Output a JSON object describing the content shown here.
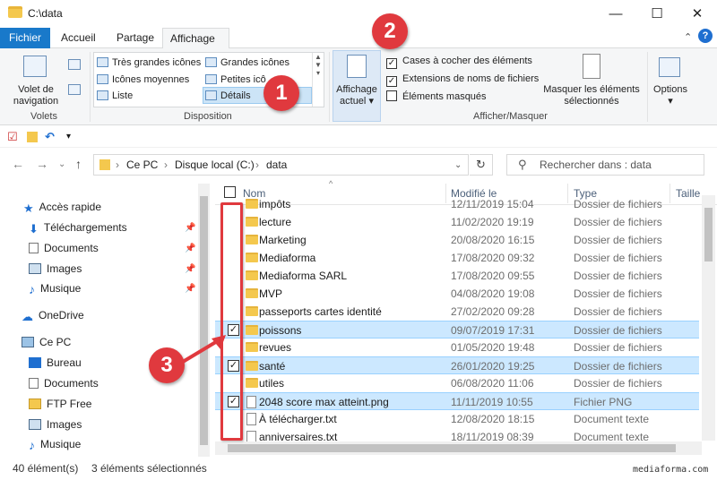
{
  "window": {
    "title": "C:\\data",
    "minimize_label": "—",
    "maximize_label": "☐",
    "close_label": "✕"
  },
  "tabs": [
    {
      "label": "Fichier"
    },
    {
      "label": "Accueil"
    },
    {
      "label": "Partage"
    },
    {
      "label": "Affichage"
    }
  ],
  "ribbon": {
    "panes": {
      "label_line1": "Volet de",
      "label_line2": "navigation",
      "group_label": "Volets"
    },
    "layout": {
      "items": [
        "Très grandes icônes",
        "Grandes icônes",
        "Icônes moyennes",
        "Petites icô",
        "Liste",
        "Détails"
      ],
      "group_label": "Disposition"
    },
    "current_view": {
      "label_line1": "Affichage",
      "label_line2": "actuel"
    },
    "show_hide": {
      "checkboxes": [
        {
          "label": "Cases à cocher des éléments",
          "checked": true
        },
        {
          "label": "Extensions de noms de fichiers",
          "checked": true
        },
        {
          "label": "Éléments masqués",
          "checked": false
        }
      ],
      "hide_selected_line1": "Masquer les éléments",
      "hide_selected_line2": "sélectionnés",
      "group_label": "Afficher/Masquer"
    },
    "options_label": "Options"
  },
  "address": {
    "crumbs": [
      "Ce PC",
      "Disque local (C:)",
      "data"
    ],
    "search_placeholder": "Rechercher dans : data"
  },
  "nav_pane": [
    {
      "label": "Accès rapide",
      "icon": "star-icon",
      "pinned": false
    },
    {
      "label": "Téléchargements",
      "icon": "download-icon",
      "pinned": true
    },
    {
      "label": "Documents",
      "icon": "document-icon",
      "pinned": true
    },
    {
      "label": "Images",
      "icon": "image-icon",
      "pinned": true
    },
    {
      "label": "Musique",
      "icon": "music-icon",
      "pinned": true
    },
    {
      "label": "OneDrive",
      "icon": "cloud-icon",
      "pinned": false
    },
    {
      "label": "Ce PC",
      "icon": "computer-icon",
      "pinned": false
    },
    {
      "label": "Bureau",
      "icon": "desktop-icon",
      "pinned": false
    },
    {
      "label": "Documents",
      "icon": "document-icon",
      "pinned": false
    },
    {
      "label": "FTP Free",
      "icon": "ftp-icon",
      "pinned": false
    },
    {
      "label": "Images",
      "icon": "image-icon",
      "pinned": false
    },
    {
      "label": "Musique",
      "icon": "music-icon",
      "pinned": false
    }
  ],
  "columns": {
    "name": "Nom",
    "modified": "Modifié le",
    "type": "Type",
    "size": "Taille"
  },
  "files": [
    {
      "name": "impôts",
      "date": "12/11/2019 15:04",
      "type": "Dossier de fichiers",
      "kind": "folder",
      "selected": false
    },
    {
      "name": "lecture",
      "date": "11/02/2020 19:19",
      "type": "Dossier de fichiers",
      "kind": "folder",
      "selected": false
    },
    {
      "name": "Marketing",
      "date": "20/08/2020 16:15",
      "type": "Dossier de fichiers",
      "kind": "folder",
      "selected": false
    },
    {
      "name": "Mediaforma",
      "date": "17/08/2020 09:32",
      "type": "Dossier de fichiers",
      "kind": "folder",
      "selected": false
    },
    {
      "name": "Mediaforma SARL",
      "date": "17/08/2020 09:55",
      "type": "Dossier de fichiers",
      "kind": "folder",
      "selected": false
    },
    {
      "name": "MVP",
      "date": "04/08/2020 19:08",
      "type": "Dossier de fichiers",
      "kind": "folder",
      "selected": false
    },
    {
      "name": "passeports cartes identité",
      "date": "27/02/2020 09:28",
      "type": "Dossier de fichiers",
      "kind": "folder",
      "selected": false
    },
    {
      "name": "poissons",
      "date": "09/07/2019 17:31",
      "type": "Dossier de fichiers",
      "kind": "folder",
      "selected": true
    },
    {
      "name": "revues",
      "date": "01/05/2020 19:48",
      "type": "Dossier de fichiers",
      "kind": "folder",
      "selected": false
    },
    {
      "name": "santé",
      "date": "26/01/2020 19:25",
      "type": "Dossier de fichiers",
      "kind": "folder",
      "selected": true
    },
    {
      "name": "utiles",
      "date": "06/08/2020 11:06",
      "type": "Dossier de fichiers",
      "kind": "folder",
      "selected": false
    },
    {
      "name": "2048 score max atteint.png",
      "date": "11/11/2019 10:55",
      "type": "Fichier PNG",
      "kind": "file",
      "selected": true
    },
    {
      "name": "À télécharger.txt",
      "date": "12/08/2020 18:15",
      "type": "Document texte",
      "kind": "file",
      "selected": false
    },
    {
      "name": "anniversaires.txt",
      "date": "18/11/2019 08:39",
      "type": "Document texte",
      "kind": "file",
      "selected": false
    }
  ],
  "status": {
    "count": "40 élément(s)",
    "selected": "3 éléments sélectionnés"
  },
  "watermark": "mediaforma.com",
  "annotations": [
    "1",
    "2",
    "3"
  ],
  "colors": {
    "accent": "#1979ca",
    "selection": "#cce8ff",
    "annotation": "#e0393e"
  }
}
